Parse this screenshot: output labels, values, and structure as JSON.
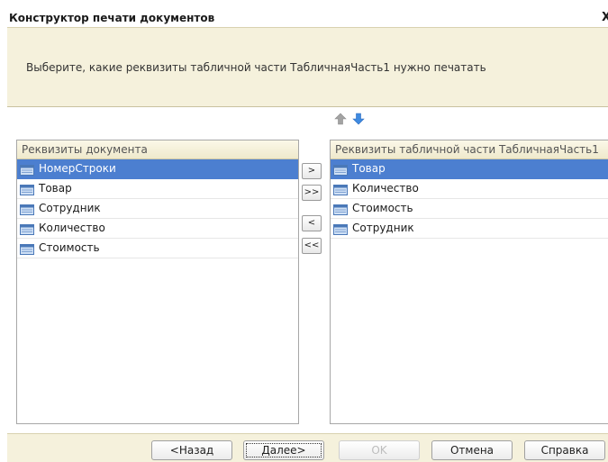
{
  "window": {
    "title": "Конструктор печати документов",
    "close_glyph": "X"
  },
  "header": {
    "instruction": "Выберите, какие реквизиты табличной части ТабличнаяЧасть1 нужно печатать"
  },
  "reorder": {
    "up_icon": "arrow-up-icon",
    "down_icon": "arrow-down-icon"
  },
  "left_panel": {
    "header": "Реквизиты документа",
    "items": [
      {
        "label": "НомерСтроки",
        "selected": true
      },
      {
        "label": "Товар",
        "selected": false
      },
      {
        "label": "Сотрудник",
        "selected": false
      },
      {
        "label": "Количество",
        "selected": false
      },
      {
        "label": "Стоимость",
        "selected": false
      }
    ]
  },
  "right_panel": {
    "header": "Реквизиты табличной части ТабличнаяЧасть1",
    "items": [
      {
        "label": "Товар",
        "selected": true
      },
      {
        "label": "Количество",
        "selected": false
      },
      {
        "label": "Стоимость",
        "selected": false
      },
      {
        "label": "Сотрудник",
        "selected": false
      }
    ]
  },
  "transfer": {
    "add_one": ">",
    "add_all": ">>",
    "remove_one": "<",
    "remove_all": "<<"
  },
  "footer": {
    "back": "<Назад",
    "next": "Далее>",
    "ok": "OK",
    "cancel": "Отмена",
    "help": "Справка"
  },
  "colors": {
    "selection": "#4c7fd0",
    "panel_bg": "#f5f1dc",
    "arrow_up": "#9a9a9a",
    "arrow_down": "#3a7fd8"
  }
}
